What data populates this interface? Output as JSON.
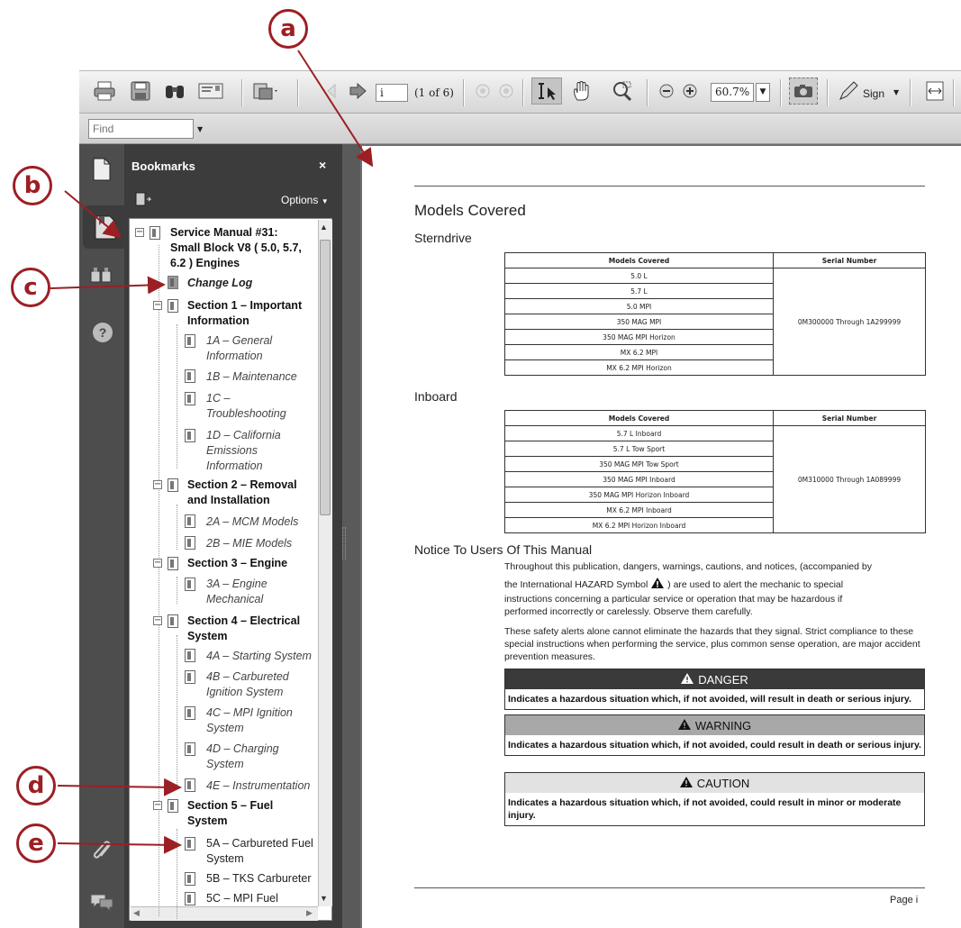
{
  "callouts": {
    "a": "a",
    "b": "b",
    "c": "c",
    "d": "d",
    "e": "e"
  },
  "toolbar": {
    "page_value": "i",
    "page_count": "(1 of 6)",
    "zoom": "60.7%",
    "sign_label": "Sign"
  },
  "find": {
    "placeholder": "Find"
  },
  "bookmarks": {
    "title": "Bookmarks",
    "close": "×",
    "options": "Options",
    "items": [
      {
        "label": "Service Manual #31:",
        "label2": "Small Block V8 ( 5.0, 5.7,",
        "label3": "6.2 ) Engines"
      },
      {
        "label": "Change Log"
      },
      {
        "label": "Section 1 – Important",
        "label2": "Information"
      },
      {
        "label": "1A – General",
        "label2": "Information"
      },
      {
        "label": "1B – Maintenance"
      },
      {
        "label": "1C –",
        "label2": "Troubleshooting"
      },
      {
        "label": "1D – California",
        "label2": "Emissions",
        "label3": "Information"
      },
      {
        "label": "Section 2 – Removal",
        "label2": "and Installation"
      },
      {
        "label": "2A – MCM Models"
      },
      {
        "label": "2B – MIE Models"
      },
      {
        "label": "Section 3 – Engine"
      },
      {
        "label": "3A – Engine",
        "label2": "Mechanical"
      },
      {
        "label": "Section 4 – Electrical",
        "label2": "System"
      },
      {
        "label": "4A – Starting System"
      },
      {
        "label": "4B – Carbureted",
        "label2": "Ignition System"
      },
      {
        "label": "4C – MPI Ignition",
        "label2": "System"
      },
      {
        "label": "4D – Charging",
        "label2": "System"
      },
      {
        "label": "4E – Instrumentation"
      },
      {
        "label": "Section 5 – Fuel",
        "label2": "System"
      },
      {
        "label": "5A – Carbureted Fuel",
        "label2": "System"
      },
      {
        "label": "5B – TKS Carbureter"
      },
      {
        "label": "5C – MPI Fuel"
      }
    ]
  },
  "document": {
    "title": "Models Covered",
    "sterndrive": {
      "heading": "Sterndrive",
      "col1": "Models Covered",
      "col2": "Serial Number",
      "rows": [
        "5.0 L",
        "5.7 L",
        "5.0 MPI",
        "350 MAG MPI",
        "350 MAG MPI Horizon",
        "MX 6.2 MPI",
        "MX 6.2 MPI Horizon"
      ],
      "serial": "0M300000 Through 1A299999"
    },
    "inboard": {
      "heading": "Inboard",
      "col1": "Models Covered",
      "col2": "Serial Number",
      "rows": [
        "5.7 L Inboard",
        "5.7 L Tow Sport",
        "350 MAG MPI Tow Sport",
        "350 MAG MPI Inboard",
        "350 MAG MPI Horizon Inboard",
        "MX 6.2 MPI Inboard",
        "MX 6.2 MPI Horizon Inboard"
      ],
      "serial": "0M310000 Through 1A089999"
    },
    "notice": {
      "heading": "Notice To Users Of This Manual",
      "p1a": "Throughout this publication, dangers, warnings, cautions, and notices, (accompanied by",
      "p1b": "the International HAZARD Symbol",
      "p1c": ") are used to alert the mechanic to special",
      "p1d": "instructions concerning a particular service or operation that may be hazardous if",
      "p1e": "performed incorrectly or carelessly. Observe them carefully.",
      "p2": "These safety alerts alone cannot eliminate the hazards that they signal. Strict compliance to these special instructions when performing the service, plus common sense operation, are major accident prevention measures."
    },
    "danger": {
      "title": "DANGER",
      "text": "Indicates a hazardous situation which, if not avoided, will result in death or serious injury."
    },
    "warning": {
      "title": "WARNING",
      "text": "Indicates a hazardous situation which, if not avoided, could result in death or serious injury."
    },
    "caution": {
      "title": "CAUTION",
      "text": "Indicates a hazardous situation which, if not avoided, could result in minor or moderate injury."
    },
    "footer": "Page i"
  },
  "colors": {
    "callout": "#9c1f24",
    "danger_header": "#3a3a3a",
    "warning_header": "#a8a8a8",
    "caution_header": "#e2e2e2"
  }
}
